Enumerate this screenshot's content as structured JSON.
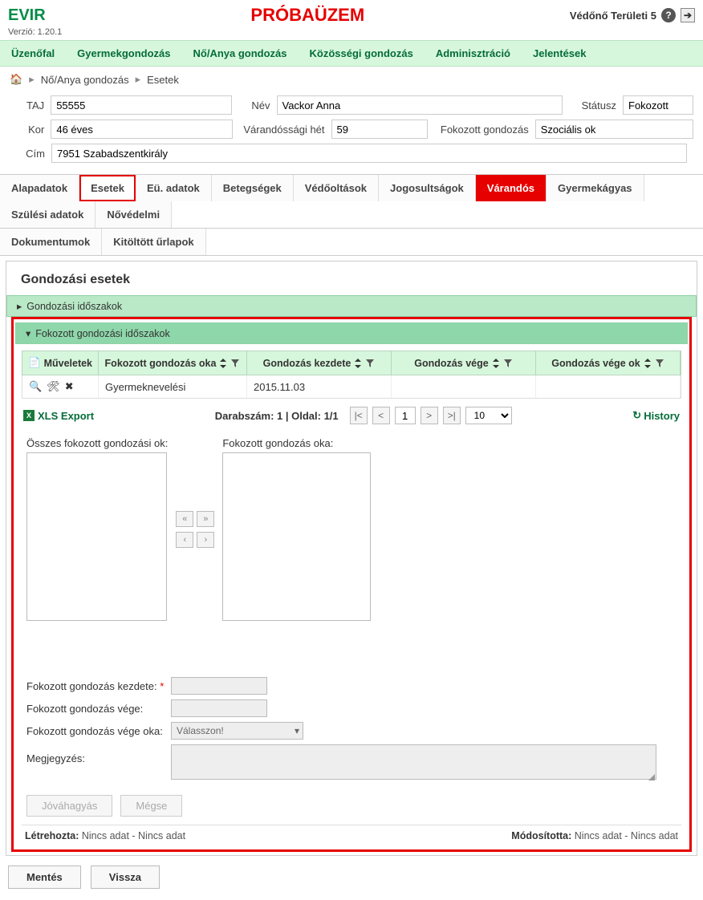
{
  "header": {
    "app": "EVIR",
    "version": "Verzió: 1.20.1",
    "banner": "PRÓBAÜZEM",
    "user": "Védőnő Területi 5"
  },
  "menu": [
    "Üzenőfal",
    "Gyermekgondozás",
    "Nő/Anya gondozás",
    "Közösségi gondozás",
    "Adminisztráció",
    "Jelentések"
  ],
  "breadcrumb": {
    "a": "Nő/Anya gondozás",
    "b": "Esetek"
  },
  "summary": {
    "taj_label": "TAJ",
    "taj": "55555",
    "nev_label": "Név",
    "nev": "Vackor Anna",
    "statusz_label": "Státusz",
    "statusz": "Fokozott",
    "kor_label": "Kor",
    "kor": "46 éves",
    "het_label": "Várandóssági hét",
    "het": "59",
    "fok_label": "Fokozott gondozás",
    "fok": "Szociális ok",
    "cim_label": "Cím",
    "cim": "7951 Szabadszentkirály"
  },
  "tabs": [
    "Alapadatok",
    "Esetek",
    "Eü. adatok",
    "Betegségek",
    "Védőoltások",
    "Jogosultságok",
    "Várandós",
    "Gyermekágyas",
    "Szülési adatok",
    "Nővédelmi"
  ],
  "tabs2": [
    "Dokumentumok",
    "Kitöltött űrlapok"
  ],
  "section_title": "Gondozási esetek",
  "acc1": "Gondozási időszakok",
  "acc2": "Fokozott gondozási időszakok",
  "grid": {
    "headers": {
      "muv": "Műveletek",
      "oka": "Fokozott gondozás oka",
      "kezd": "Gondozás kezdete",
      "vege": "Gondozás vége",
      "vegeok": "Gondozás vége ok"
    },
    "row": {
      "oka": "Gyermeknevelési",
      "kezd": "2015.11.03",
      "vege": "",
      "vegeok": ""
    }
  },
  "pager": {
    "xls": "XLS Export",
    "counts": "Darabszám: 1 | Oldal: 1/1",
    "page": "1",
    "size": "10",
    "history": "History"
  },
  "dual": {
    "left": "Összes fokozott gondozási ok:",
    "right": "Fokozott gondozás oka:"
  },
  "form": {
    "kezd": "Fokozott gondozás kezdete:",
    "vege": "Fokozott gondozás vége:",
    "vegeok": "Fokozott gondozás vége oka:",
    "vegeok_placeholder": "Válasszon!",
    "megj": "Megjegyzés:",
    "approve": "Jóváhagyás",
    "cancel": "Mégse"
  },
  "meta": {
    "created_l": "Létrehozta:",
    "created_v": "Nincs adat - Nincs adat",
    "mod_l": "Módosította:",
    "mod_v": "Nincs adat - Nincs adat"
  },
  "bottom": {
    "save": "Mentés",
    "back": "Vissza"
  }
}
